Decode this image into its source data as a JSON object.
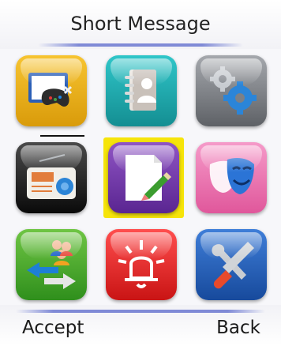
{
  "header": {
    "title": "Short Message"
  },
  "menu": {
    "items": [
      {
        "icon": "gamepad-tv-icon",
        "colors": [
          "#f7c431",
          "#d99b0a"
        ]
      },
      {
        "icon": "contacts-book-icon",
        "colors": [
          "#2fc6c9",
          "#148e92"
        ]
      },
      {
        "icon": "gears-settings-icon",
        "colors": [
          "#a5a8ad",
          "#5e6166"
        ]
      },
      {
        "icon": "radio-icon",
        "colors": [
          "#4a4a4a",
          "#0a0a0a"
        ]
      },
      {
        "icon": "notepad-pencil-icon",
        "colors": [
          "#8f55c4",
          "#5a2591"
        ]
      },
      {
        "icon": "theater-masks-icon",
        "colors": [
          "#f59ac9",
          "#e0579b"
        ]
      },
      {
        "icon": "people-transfer-icon",
        "colors": [
          "#6fc544",
          "#2f8f1c"
        ]
      },
      {
        "icon": "alarm-bell-icon",
        "colors": [
          "#ff4e4e",
          "#c91414"
        ]
      },
      {
        "icon": "tools-icon",
        "colors": [
          "#3f7ed8",
          "#174a9c"
        ]
      }
    ],
    "selected_index": 4,
    "highlight_color": "#f6e40a"
  },
  "softkeys": {
    "left": "Accept",
    "right": "Back"
  }
}
